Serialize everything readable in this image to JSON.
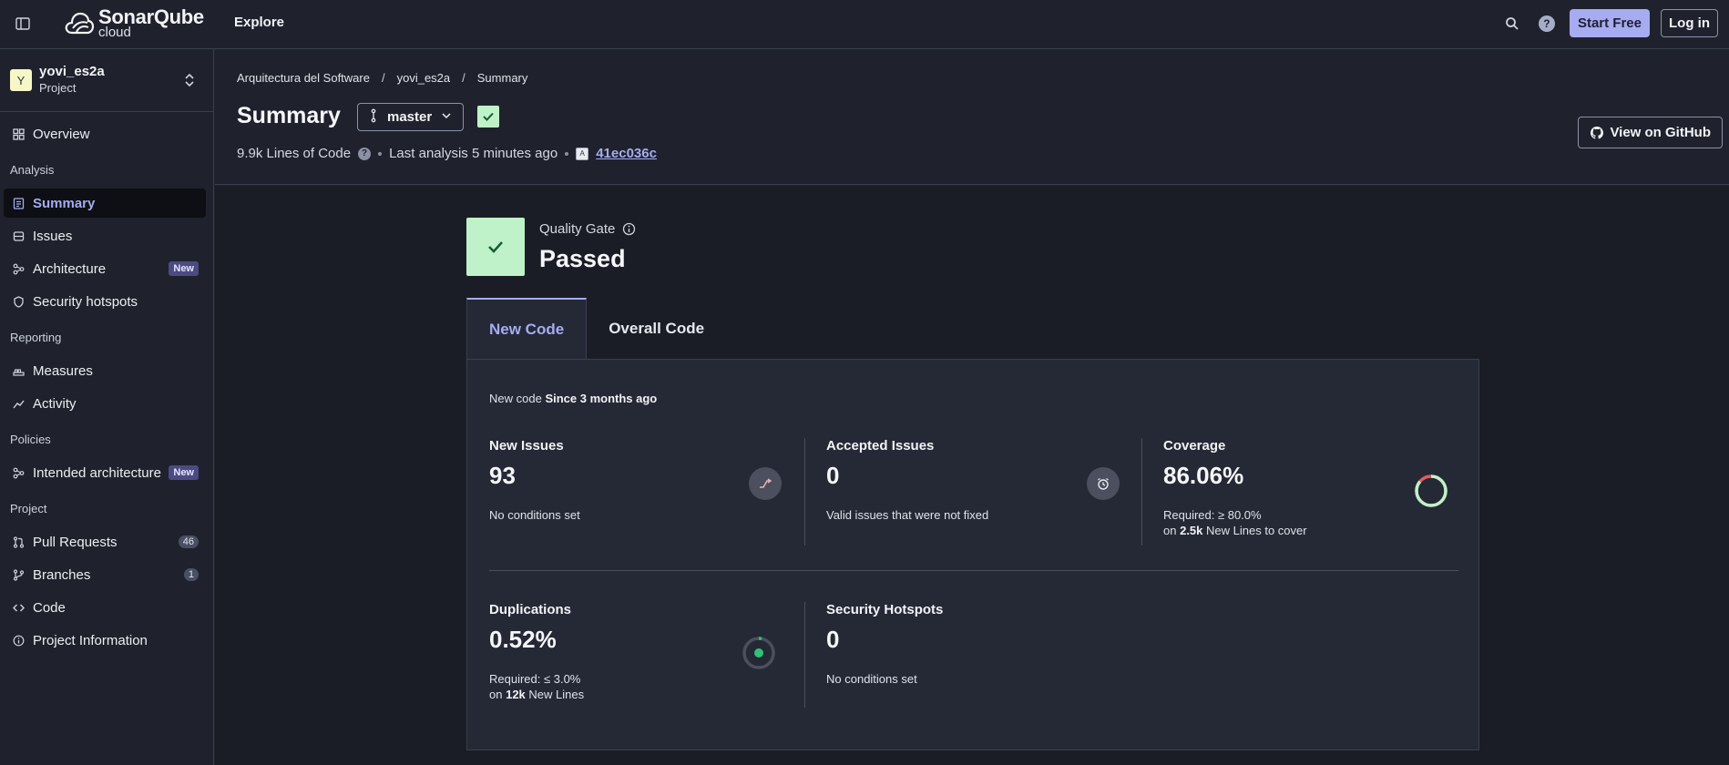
{
  "topbar": {
    "logo_top": "SonarQube",
    "logo_bottom": "cloud",
    "explore": "Explore",
    "start_free": "Start Free",
    "login": "Log in",
    "help": "?"
  },
  "sidebar": {
    "project_avatar": "Y",
    "project_name": "yovi_es2a",
    "project_type": "Project",
    "overview": "Overview",
    "sections": {
      "analysis": "Analysis",
      "reporting": "Reporting",
      "policies": "Policies",
      "project": "Project"
    },
    "items": {
      "summary": "Summary",
      "issues": "Issues",
      "architecture": "Architecture",
      "security_hotspots": "Security hotspots",
      "measures": "Measures",
      "activity": "Activity",
      "intended_architecture": "Intended architecture",
      "pull_requests": "Pull Requests",
      "branches": "Branches",
      "code": "Code",
      "project_information": "Project Information"
    },
    "badges": {
      "new": "New",
      "pull_requests_count": "46",
      "branches_count": "1"
    }
  },
  "header": {
    "breadcrumb": [
      "Arquitectura del Software",
      "yovi_es2a",
      "Summary"
    ],
    "title": "Summary",
    "branch": "master",
    "lines_of_code": "9.9k Lines of Code",
    "last_analysis": "Last analysis 5 minutes ago",
    "commit_icon": "A",
    "commit_hash": "41ec036c",
    "github_button": "View on GitHub"
  },
  "quality_gate": {
    "label": "Quality Gate",
    "status": "Passed"
  },
  "tabs": {
    "new_code": "New Code",
    "overall_code": "Overall Code"
  },
  "panel": {
    "new_code_prefix": "New code",
    "new_code_since": "Since 3 months ago",
    "metrics": {
      "new_issues": {
        "title": "New Issues",
        "value": "93",
        "note": "No conditions set"
      },
      "accepted_issues": {
        "title": "Accepted Issues",
        "value": "0",
        "note": "Valid issues that were not fixed"
      },
      "coverage": {
        "title": "Coverage",
        "value": "86.06%",
        "note1": "Required: ≥ 80.0%",
        "note2_prefix": "on",
        "note2_bold": "2.5k",
        "note2_suffix": "New Lines to cover",
        "fraction": 0.8606
      },
      "duplications": {
        "title": "Duplications",
        "value": "0.52%",
        "note1": "Required: ≤ 3.0%",
        "note2_prefix": "on",
        "note2_bold": "12k",
        "note2_suffix": "New Lines",
        "fraction": 0.0052
      },
      "security_hotspots": {
        "title": "Security Hotspots",
        "value": "0",
        "note": "No conditions set"
      }
    }
  },
  "colors": {
    "accent": "#a7abf0",
    "passed": "#bff2c9",
    "coverage_good": "#bff2c9",
    "coverage_bad": "#e35d5d",
    "duplication_dot": "#2fc278"
  }
}
